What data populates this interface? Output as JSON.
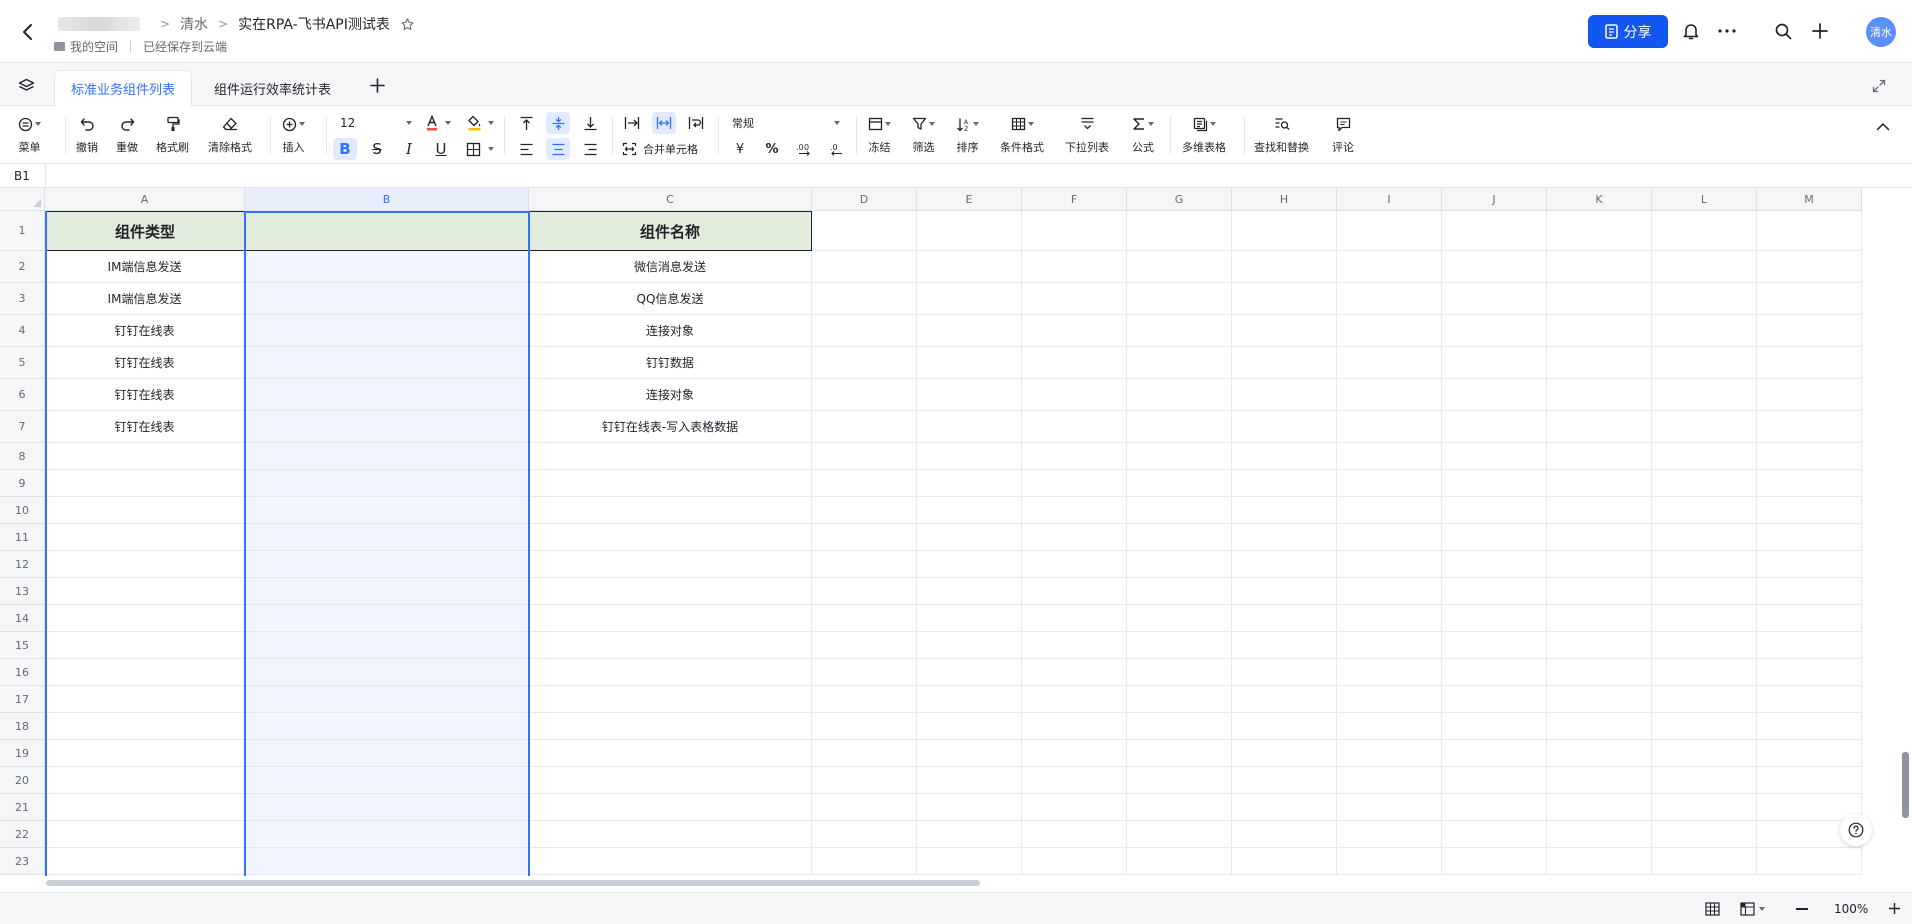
{
  "header": {
    "breadcrumb": [
      "清水",
      "实在RPA-飞书API测试表"
    ],
    "location": "我的空间",
    "save_status": "已经保存到云端",
    "share_label": "分享",
    "avatar_text": "清水",
    "brand_color": "#1456f0"
  },
  "sheets": {
    "tabs": [
      "标准业务组件列表",
      "组件运行效率统计表"
    ],
    "active_index": 0
  },
  "toolbar": {
    "menu": "菜单",
    "undo": "撤销",
    "redo": "重做",
    "format_painter": "格式刷",
    "clear_format": "清除格式",
    "insert": "插入",
    "font_size": "12",
    "merge_cells": "合并单元格",
    "number_format": "常规",
    "currency": "¥",
    "percent": "%",
    "freeze": "冻结",
    "filter": "筛选",
    "sort": "排序",
    "conditional_format": "条件格式",
    "dropdown_list": "下拉列表",
    "formula": "公式",
    "multi_dim_table": "多维表格",
    "find_replace": "查找和替换",
    "comment": "评论"
  },
  "formula_bar": {
    "cell_ref": "B1",
    "value": ""
  },
  "grid": {
    "columns": [
      "A",
      "B",
      "C",
      "D",
      "E",
      "F",
      "G",
      "H",
      "I",
      "J",
      "K",
      "L",
      "M"
    ],
    "selected_column": "B",
    "row_numbers": [
      "1",
      "2",
      "3",
      "4",
      "5",
      "6",
      "7",
      "8",
      "9",
      "10",
      "11",
      "12",
      "13",
      "14",
      "15",
      "16",
      "17",
      "18",
      "19",
      "20",
      "21",
      "22",
      "23"
    ],
    "header_row": [
      "组件类型",
      "",
      "组件名称"
    ],
    "rows": [
      [
        "IM端信息发送",
        "",
        "微信消息发送"
      ],
      [
        "IM端信息发送",
        "",
        "QQ信息发送"
      ],
      [
        "钉钉在线表",
        "",
        "连接对象"
      ],
      [
        "钉钉在线表",
        "",
        "钉钉数据"
      ],
      [
        "钉钉在线表",
        "",
        "连接对象"
      ],
      [
        "钉钉在线表",
        "",
        "钉钉在线表-写入表格数据"
      ]
    ],
    "header_fill": "#e2ecdc",
    "selection_color": "#3370ff"
  },
  "statusbar": {
    "zoom": "100%"
  }
}
